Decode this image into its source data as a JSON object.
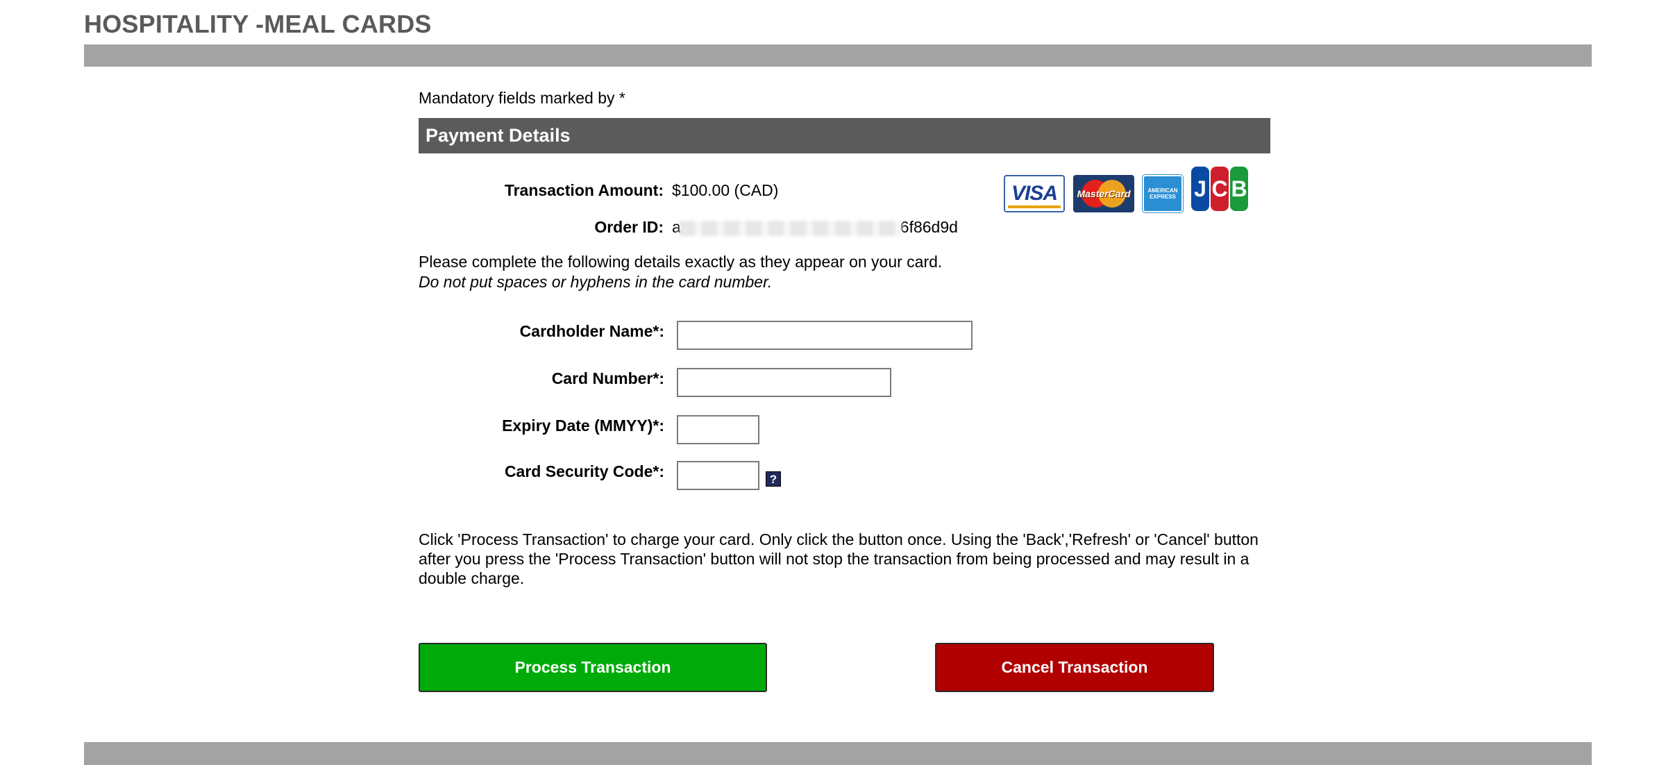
{
  "header": {
    "title": "HOSPITALITY -MEAL CARDS"
  },
  "form": {
    "mandatory_note": "Mandatory fields marked by *",
    "section_title": "Payment Details",
    "transaction_amount_label": "Transaction Amount:",
    "transaction_amount_value": "$100.00 (CAD)",
    "order_id_label": "Order ID:",
    "order_id_prefix": "a",
    "order_id_suffix": "6f86d9d",
    "card_logos": [
      "VISA",
      "MasterCard",
      "AMERICAN EXPRESS",
      "JCB"
    ],
    "instructions_line1": "Please complete the following details exactly as they appear on your card.",
    "instructions_line2": "Do not put spaces or hyphens in the card number.",
    "fields": {
      "cardholder_name_label": "Cardholder Name*:",
      "cardholder_name_value": "",
      "card_number_label": "Card Number*:",
      "card_number_value": "",
      "expiry_label": "Expiry Date (MMYY)*:",
      "expiry_value": "",
      "security_code_label": "Card Security Code*:",
      "security_code_value": "",
      "security_help_glyph": "?"
    },
    "notice": "Click 'Process Transaction' to charge your card. Only click the button once. Using the 'Back','Refresh' or 'Cancel' button after you press the 'Process Transaction' button will not stop the transaction from being processed and may result in a double charge.",
    "process_button": "Process Transaction",
    "cancel_button": "Cancel Transaction"
  },
  "colors": {
    "section_bar": "#a3a3a3",
    "section_header": "#5b5b5b",
    "process_button": "#00ab0a",
    "cancel_button": "#b10000"
  }
}
